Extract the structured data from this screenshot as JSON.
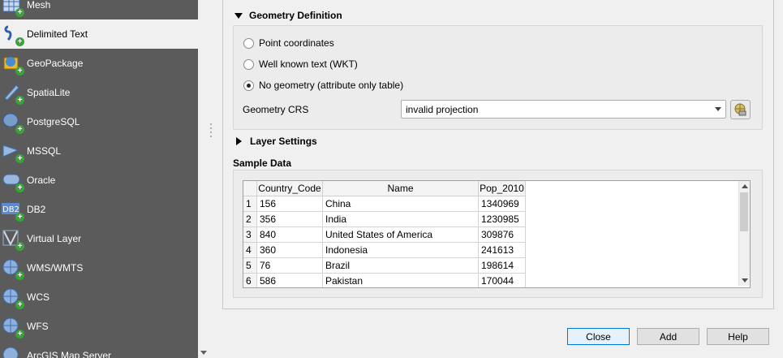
{
  "sidebar": {
    "items": [
      {
        "label": "Mesh",
        "icon": "mesh-icon"
      },
      {
        "label": "Delimited Text",
        "icon": "delimited-text-icon",
        "selected": true
      },
      {
        "label": "GeoPackage",
        "icon": "geopackage-icon"
      },
      {
        "label": "SpatiaLite",
        "icon": "spatialite-icon"
      },
      {
        "label": "PostgreSQL",
        "icon": "postgresql-icon"
      },
      {
        "label": "MSSQL",
        "icon": "mssql-icon"
      },
      {
        "label": "Oracle",
        "icon": "oracle-icon"
      },
      {
        "label": "DB2",
        "icon": "db2-icon"
      },
      {
        "label": "Virtual Layer",
        "icon": "virtual-layer-icon"
      },
      {
        "label": "WMS/WMTS",
        "icon": "wms-icon"
      },
      {
        "label": "WCS",
        "icon": "wcs-icon"
      },
      {
        "label": "WFS",
        "icon": "wfs-icon"
      },
      {
        "label": "ArcGIS Map Server",
        "icon": "arcgis-map-server-icon"
      }
    ]
  },
  "geometry_definition": {
    "title": "Geometry Definition",
    "options": [
      {
        "label": "Point coordinates",
        "checked": false
      },
      {
        "label": "Well known text (WKT)",
        "checked": false
      },
      {
        "label": "No geometry (attribute only table)",
        "checked": true
      }
    ],
    "crs_label": "Geometry CRS",
    "crs_value": "invalid projection"
  },
  "layer_settings": {
    "title": "Layer Settings"
  },
  "sample_data": {
    "title": "Sample Data",
    "columns": [
      "Country_Code",
      "Name",
      "Pop_2010"
    ],
    "rows": [
      {
        "n": "1",
        "cells": [
          "156",
          "China",
          "1340969"
        ]
      },
      {
        "n": "2",
        "cells": [
          "356",
          "India",
          "1230985"
        ]
      },
      {
        "n": "3",
        "cells": [
          "840",
          "United States of America",
          "309876"
        ]
      },
      {
        "n": "4",
        "cells": [
          "360",
          "Indonesia",
          "241613"
        ]
      },
      {
        "n": "5",
        "cells": [
          "76",
          "Brazil",
          "198614"
        ]
      },
      {
        "n": "6",
        "cells": [
          "586",
          "Pakistan",
          "170044"
        ]
      }
    ]
  },
  "buttons": {
    "close": "Close",
    "add": "Add",
    "help": "Help"
  },
  "colors": {
    "sidebar_bg": "#5b5b5b",
    "accent_plus": "#3aa33a",
    "primary_border": "#0078d7"
  }
}
